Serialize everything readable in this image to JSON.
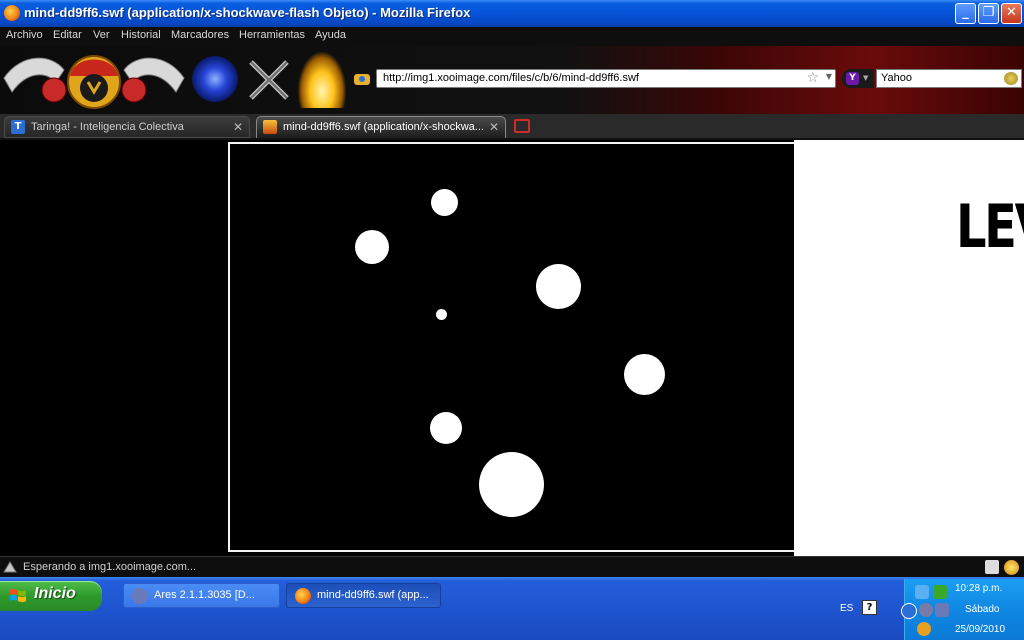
{
  "window": {
    "title": "mind-dd9ff6.swf (application/x-shockwave-flash Objeto) - Mozilla Firefox",
    "minimize_label": "_",
    "maximize_label": "❐",
    "close_label": "✕"
  },
  "menu": {
    "items": [
      "Archivo",
      "Editar",
      "Ver",
      "Historial",
      "Marcadores",
      "Herramientas",
      "Ayuda"
    ]
  },
  "navigation": {
    "url": "http://img1.xooimage.com/files/c/b/6/mind-dd9ff6.swf",
    "search_engine": "Yahoo",
    "search_engine_icon": "yahoo-icon",
    "search_engine_glyph": "Y"
  },
  "tabs": [
    {
      "label": "Taringa! - Inteligencia Colectiva",
      "icon": "taringa-icon",
      "glyph": "T",
      "active": false
    },
    {
      "label": "mind-dd9ff6.swf (application/x-shockwa...",
      "icon": "flash-file-icon",
      "active": true
    }
  ],
  "tab_close": "✕",
  "content": {
    "side_text": "LEV",
    "background": "#000000"
  },
  "status": {
    "text": "Esperando a img1.xooimage.com..."
  },
  "taskbar": {
    "start_label": "Inicio",
    "tasks": [
      {
        "label": "Ares 2.1.1.3035   [D...",
        "icon": "ares-icon"
      },
      {
        "label": "mind-dd9ff6.swf (app...",
        "icon": "firefox-icon"
      }
    ],
    "language": "ES",
    "help_glyph": "?",
    "clock_time": "10:28 p.m.",
    "clock_day": "Sábado",
    "clock_date": "25/09/2010"
  },
  "colors": {
    "titlebar": "#0553d6",
    "taskbar": "#245edb",
    "start_button": "#2f9a2c",
    "tray": "#0f88e3"
  }
}
